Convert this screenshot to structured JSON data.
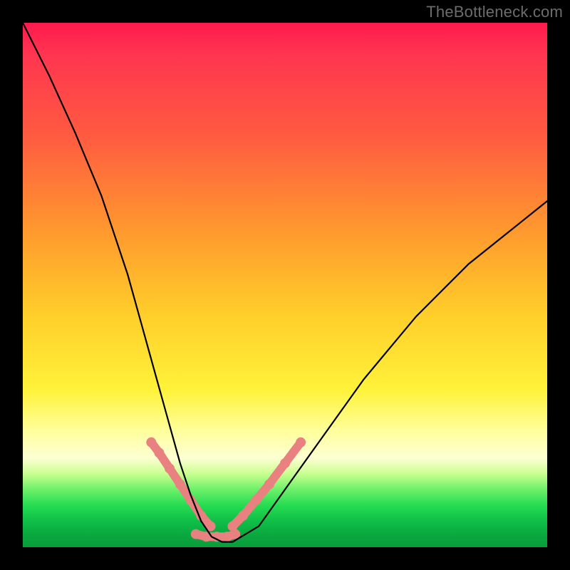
{
  "watermark": "TheBottleneck.com",
  "chart_data": {
    "type": "line",
    "title": "",
    "xlabel": "",
    "ylabel": "",
    "xlim": [
      0,
      1
    ],
    "ylim": [
      0,
      100
    ],
    "series": [
      {
        "name": "bottleneck-curve",
        "x": [
          0.0,
          0.05,
          0.1,
          0.15,
          0.2,
          0.225,
          0.25,
          0.275,
          0.3,
          0.32,
          0.34,
          0.36,
          0.38,
          0.4,
          0.45,
          0.5,
          0.55,
          0.6,
          0.65,
          0.7,
          0.75,
          0.8,
          0.85,
          0.9,
          0.95,
          1.0
        ],
        "y": [
          100,
          90,
          79,
          67,
          52,
          43,
          34,
          25,
          16,
          10,
          5,
          2,
          1,
          1,
          4,
          11,
          18,
          25,
          32,
          38,
          44,
          49,
          54,
          58,
          62,
          66
        ]
      }
    ],
    "highlight_band": {
      "name": "acceptable-zone",
      "color": "#e98180",
      "left": {
        "x": [
          0.245,
          0.26,
          0.28,
          0.3,
          0.32,
          0.34,
          0.358
        ],
        "y": [
          20,
          18,
          15,
          12,
          9,
          6,
          4
        ]
      },
      "right": {
        "x": [
          0.4,
          0.42,
          0.445,
          0.47,
          0.5,
          0.53
        ],
        "y": [
          4,
          6,
          9,
          12,
          16,
          20
        ]
      },
      "bottom": {
        "x": [
          0.33,
          0.35,
          0.37,
          0.39,
          0.405
        ],
        "y": [
          2.5,
          2,
          2,
          2,
          2.5
        ]
      }
    },
    "colors": {
      "curve": "#000000",
      "highlight": "#e98180",
      "gradient_top": "#ff1a4d",
      "gradient_mid": "#fff23a",
      "gradient_bottom": "#099e3c"
    }
  }
}
